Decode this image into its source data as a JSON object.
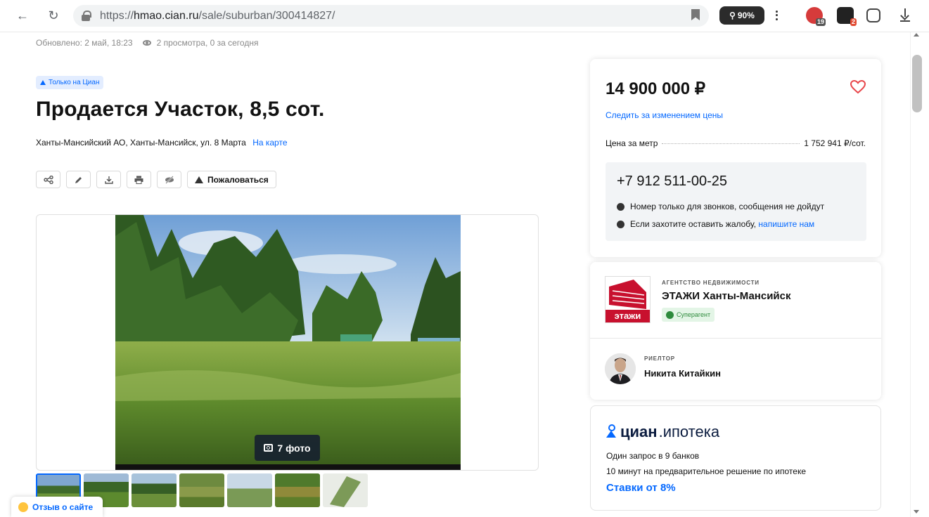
{
  "browser": {
    "url_prefix": "https://",
    "url_host": "hmao.cian.ru",
    "url_path": "/sale/suburban/300414827/",
    "zoom": "90%",
    "ext1_badge": "19",
    "ext2_badge": "2"
  },
  "meta": {
    "updated": "Обновлено: 2 май, 18:23",
    "views": "2 просмотра, 0 за сегодня"
  },
  "listing": {
    "only_cian": "Только на Циан",
    "title": "Продается Участок, 8,5 сот.",
    "address": "Ханты-Мансийский АО, Ханты-Мансийск, ул. 8 Марта",
    "map_link": "На карте",
    "complain_label": "Пожаловаться",
    "photo_count": "7 фото"
  },
  "price_card": {
    "price": "14 900 000 ₽",
    "track_price": "Следить за изменением цены",
    "per_unit_label": "Цена за метр",
    "per_unit_value": "1 752 941 ₽/сот.",
    "phone": "+7 912 511-00-25",
    "calls_only": "Номер только для звонков, сообщения не дойдут",
    "complaint_text": "Если захотите оставить жалобу,",
    "complaint_link": "напишите нам"
  },
  "agency": {
    "type": "АГЕНТСТВО НЕДВИЖИМОСТИ",
    "name": "ЭТАЖИ Ханты-Мансийск",
    "logo_text": "этажи",
    "badge": "Суперагент",
    "realtor_role": "РИЕЛТОР",
    "realtor_name": "Никита Китайкин"
  },
  "mortgage": {
    "brand": "циан",
    "product": ".ипотека",
    "line1": "Один запрос в 9 банков",
    "line2": "10 минут на предварительное решение по ипотеке",
    "rate": "Ставки от 8%"
  },
  "feedback": {
    "label": "Отзыв о сайте"
  },
  "colors": {
    "accent": "#0468ff",
    "brand_red": "#c8102e",
    "heart": "#e8474b"
  }
}
